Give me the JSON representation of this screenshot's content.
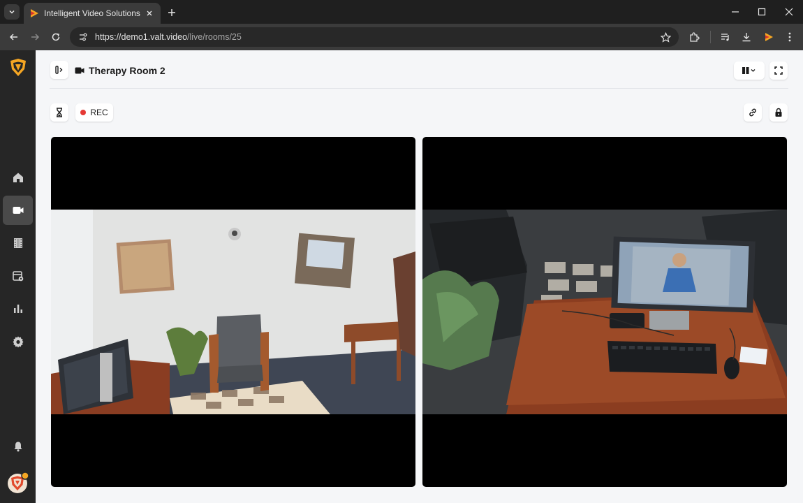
{
  "browser": {
    "tab_title": "Intelligent Video Solutions",
    "url_host": "https://demo1.valt.video",
    "url_path": "/live/rooms/25"
  },
  "room": {
    "title": "Therapy Room 2",
    "rec_label": "REC"
  },
  "sidebar": {
    "items": [
      "home-icon",
      "video-camera-icon",
      "film-icon",
      "calendar-settings-icon",
      "bar-chart-icon",
      "gear-icon",
      "bell-icon"
    ],
    "active": "video-camera-icon"
  },
  "cameras": [
    {
      "scene": "therapy room with armchair, wall pictures and computer desk"
    },
    {
      "scene": "desk with monitor, keyboard and mouse, armchairs behind"
    }
  ],
  "colors": {
    "accent": "#f5a623",
    "rec": "#e53935"
  }
}
